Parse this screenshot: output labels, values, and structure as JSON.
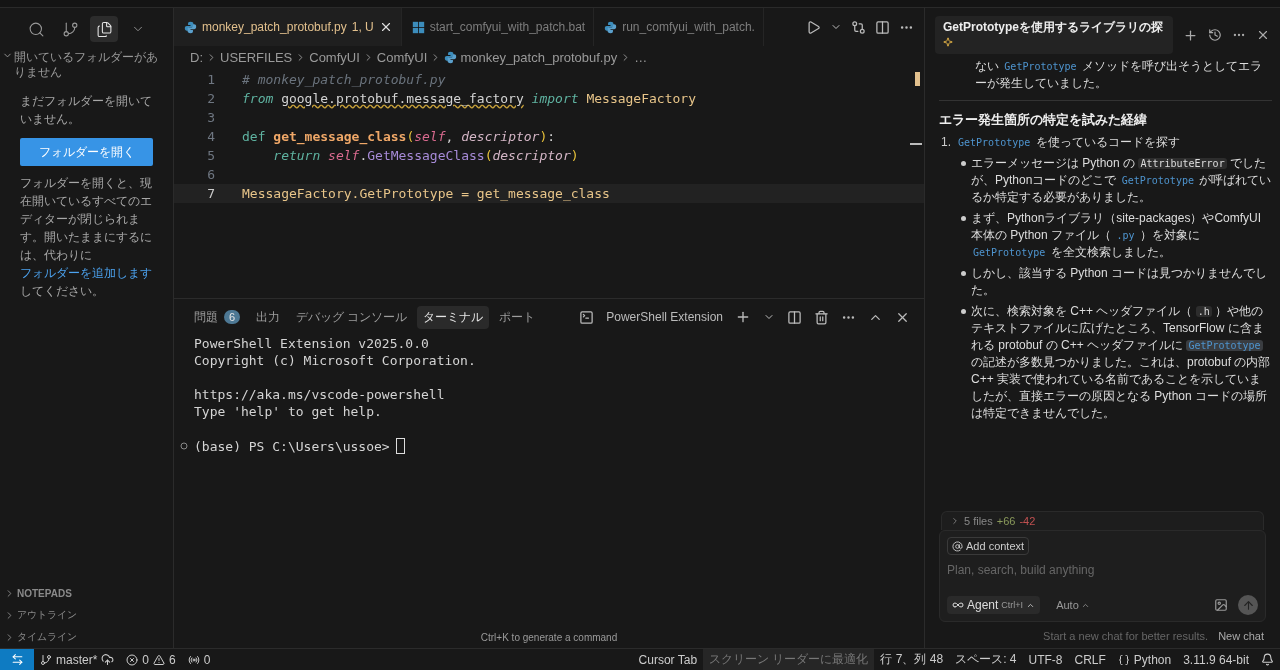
{
  "activity_icons": [
    {
      "kind": "search",
      "selected": false
    },
    {
      "kind": "branch",
      "selected": false
    },
    {
      "kind": "files",
      "selected": true
    },
    {
      "kind": "chevron",
      "selected": false
    }
  ],
  "sidebar": {
    "section_title": "開いているフォルダーがありません",
    "message": "まだフォルダーを開いていません。",
    "open_button": "フォルダーを開く",
    "note_before": "フォルダーを開くと、現在開いているすべてのエディターが閉じられます。開いたままにするには、代わりに",
    "note_link": "フォルダーを追加します",
    "note_after": "してください。",
    "bottom_sections": [
      "NOTEPADS",
      "アウトライン",
      "タイムライン"
    ]
  },
  "editor_tabs": [
    {
      "label": "monkey_patch_protobuf.py",
      "badge": "1, U",
      "kind": "python",
      "selected": true
    },
    {
      "label": "start_comfyui_with_patch.bat",
      "kind": "windows",
      "selected": false
    },
    {
      "label": "run_comfyui_with_patch.",
      "kind": "python",
      "selected": false
    }
  ],
  "breadcrumbs": [
    "D:",
    "USERFILES",
    "ComfyUI",
    "ComfyUI",
    "monkey_patch_protobuf.py",
    "…"
  ],
  "code_lines": [
    {
      "number": "1",
      "current": false,
      "tokens": [
        {
          "kind": "comment",
          "text": "# monkey_patch_protobuf.py"
        }
      ]
    },
    {
      "number": "2",
      "current": false,
      "tokens": [
        {
          "kind": "keyword",
          "text": "from "
        },
        {
          "kind": "warning",
          "text": "google.protobuf.message_factory"
        },
        {
          "kind": "keyword",
          "text": " import "
        },
        {
          "kind": "class",
          "text": "MessageFactory"
        }
      ]
    },
    {
      "number": "3",
      "current": false
    },
    {
      "number": "4",
      "current": false,
      "tokens": [
        {
          "kind": "def",
          "text": "def "
        },
        {
          "kind": "function",
          "text": "get_message_class"
        },
        {
          "kind": "paren",
          "text": "("
        },
        {
          "kind": "self",
          "text": "self"
        },
        {
          "kind": "plain",
          "text": ", "
        },
        {
          "kind": "param",
          "text": "descriptor"
        },
        {
          "kind": "paren",
          "text": ")"
        },
        {
          "kind": "plain",
          "text": ":"
        }
      ]
    },
    {
      "number": "5",
      "current": false,
      "tokens": [
        {
          "kind": "keyword",
          "text": "    return "
        },
        {
          "kind": "self",
          "text": "self"
        },
        {
          "kind": "plain",
          "text": "."
        },
        {
          "kind": "method",
          "text": "GetMessageClass"
        },
        {
          "kind": "paren",
          "text": "("
        },
        {
          "kind": "param",
          "text": "descriptor"
        },
        {
          "kind": "paren",
          "text": ")"
        }
      ]
    },
    {
      "number": "6",
      "current": false
    },
    {
      "number": "7",
      "current": true,
      "tokens": [
        {
          "kind": "class",
          "text": "MessageFactory.GetPrototype = get_message_class"
        }
      ]
    }
  ],
  "panel_tabs": [
    {
      "label": "問題",
      "badge": "6",
      "selected": false
    },
    {
      "label": "出力",
      "selected": false
    },
    {
      "label": "デバッグ コンソール",
      "selected": false
    },
    {
      "label": "ターミナル",
      "selected": true
    },
    {
      "label": "ポート",
      "selected": false
    }
  ],
  "terminal_name": "PowerShell Extension",
  "terminal_paragraphs": [
    [
      "PowerShell Extension v2025.0.0",
      "Copyright (c) Microsoft Corporation."
    ],
    [
      "https://aka.ms/vscode-powershell",
      "Type 'help' to get help."
    ]
  ],
  "prompt": "(base) PS C:\\Users\\ussoe>",
  "terminal_hint": "Ctrl+K to generate a command",
  "chat": {
    "title": "GetPrototypeを使用するライブラリの探",
    "blocks": [
      {
        "kind": "continuation",
        "segments": [
          {
            "kind": "text",
            "text": "ない "
          },
          {
            "kind": "code",
            "text": "GetPrototype"
          },
          {
            "kind": "text",
            "text": " メソッドを呼び出そうとしてエラーが発生していました。"
          }
        ]
      },
      {
        "kind": "rule"
      },
      {
        "kind": "heading",
        "segments": [
          {
            "kind": "text",
            "text": "エラー発生箇所の特定を試みた経緯"
          }
        ]
      },
      {
        "kind": "numbered",
        "number": "1.",
        "segments": [
          {
            "kind": "code",
            "text": "GetPrototype"
          },
          {
            "kind": "text",
            "text": " を使っているコードを探す"
          }
        ]
      },
      {
        "kind": "bullet",
        "segments": [
          {
            "kind": "text",
            "text": "エラーメッセージは Python の "
          },
          {
            "kind": "chip",
            "text": "AttributeError"
          },
          {
            "kind": "text",
            "text": " でしたが、Pythonコードのどこで "
          },
          {
            "kind": "code",
            "text": "GetPrototype"
          },
          {
            "kind": "text",
            "text": " が呼ばれているか特定する必要がありました。"
          }
        ]
      },
      {
        "kind": "bullet",
        "segments": [
          {
            "kind": "text",
            "text": "まず、Pythonライブラリ（site-packages）やComfyUI本体の Python ファイル（ "
          },
          {
            "kind": "code",
            "text": ".py"
          },
          {
            "kind": "text",
            "text": " ）を対象に "
          },
          {
            "kind": "code",
            "text": "GetPrototype"
          },
          {
            "kind": "text",
            "text": " を全文検索しました。"
          }
        ]
      },
      {
        "kind": "bullet",
        "segments": [
          {
            "kind": "text",
            "text": "しかし、該当する Python コードは見つかりませんでした。"
          }
        ]
      },
      {
        "kind": "bullet",
        "segments": [
          {
            "kind": "text",
            "text": "次に、検索対象を C++ ヘッダファイル（ "
          },
          {
            "kind": "chip",
            "text": ".h"
          },
          {
            "kind": "text",
            "text": " ）や他のテキストファイルに広げたところ、TensorFlow に含まれる protobuf の C++ ヘッダファイルに "
          },
          {
            "kind": "highlight",
            "text": "GetPrototype"
          },
          {
            "kind": "text",
            "text": " の記述が多数見つかりました。これは、protobuf の内部 C++ 実装で使われている名前であることを示していましたが、直接エラーの原因となる Python コードの場所は特定できませんでした。"
          }
        ]
      }
    ],
    "files_summary": {
      "files": "5 files",
      "added": "+66",
      "removed": "-42"
    },
    "context_chip": "Add context",
    "placeholder": "Plan, search, build anything",
    "mode": "Agent",
    "mode_shortcut": "Ctrl+I",
    "model": "Auto",
    "footer_hint": "Start a new chat for better results.",
    "new_chat": "New chat"
  },
  "status_bar": {
    "branch": "master*",
    "errors": "0",
    "warnings": "6",
    "ports": "0",
    "right": [
      {
        "text": "Cursor Tab",
        "kind": "plain"
      },
      {
        "text": "スクリーン リーダーに最適化",
        "kind": "muted"
      },
      {
        "text": "行 7、列 48",
        "kind": "plain"
      },
      {
        "text": "スペース: 4",
        "kind": "plain"
      },
      {
        "text": "UTF-8",
        "kind": "plain"
      },
      {
        "text": "CRLF",
        "kind": "plain"
      },
      {
        "text": "Python",
        "kind": "language"
      },
      {
        "text": "3.11.9 64-bit",
        "kind": "plain"
      }
    ]
  }
}
